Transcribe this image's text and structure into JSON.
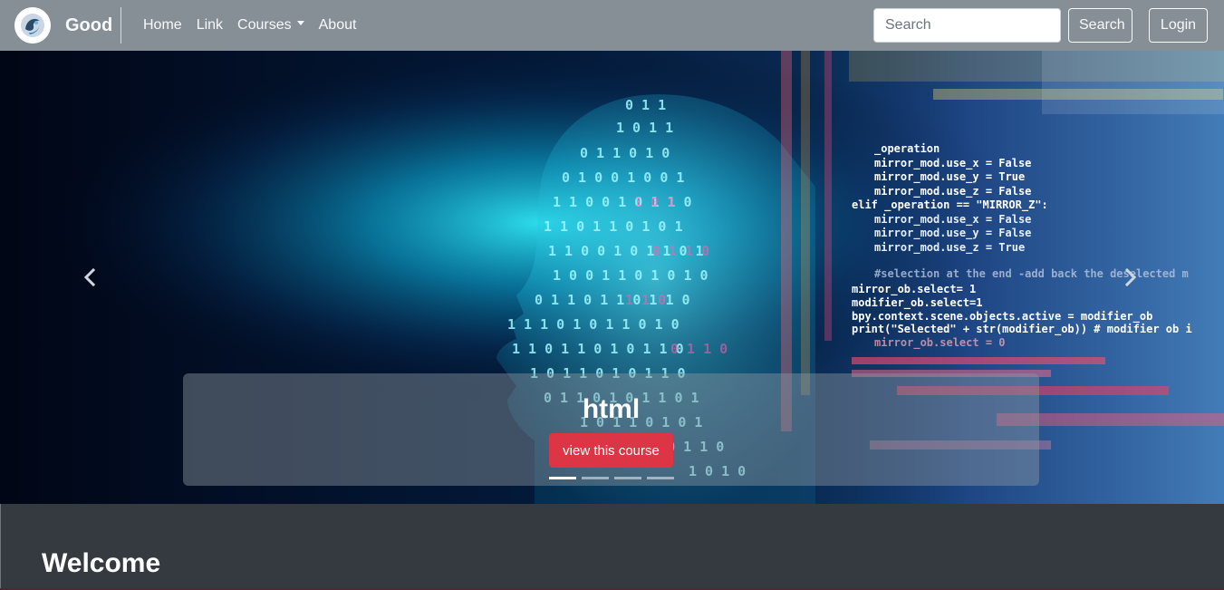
{
  "navbar": {
    "brand": "Good",
    "links": [
      {
        "label": "Home"
      },
      {
        "label": "Link"
      },
      {
        "label": "Courses"
      },
      {
        "label": "About"
      }
    ],
    "search_placeholder": "Search",
    "search_button": "Search",
    "login_button": "Login",
    "background_color": "#868e96"
  },
  "carousel": {
    "slide_title": "html",
    "button_label": "view this course",
    "button_color": "#dc3545",
    "indicators_total": 4,
    "indicator_active_index": 0,
    "prev_icon": "chevron-left-icon",
    "next_icon": "chevron-right-icon",
    "image_content": [
      "ai-head-silhouette",
      "binary-digits",
      "source-code-lines"
    ]
  },
  "welcome": {
    "title": "Welcome"
  }
}
